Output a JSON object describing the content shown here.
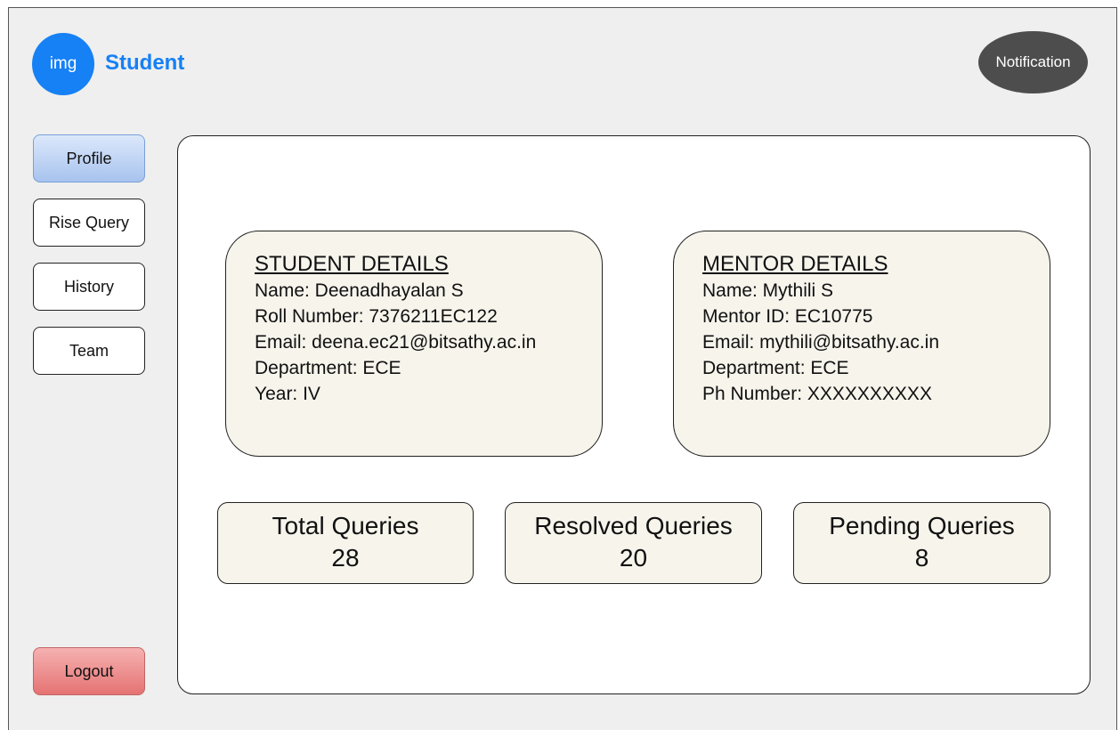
{
  "header": {
    "avatar_label": "img",
    "app_title": "Student",
    "notification_label": "Notification"
  },
  "sidebar": {
    "items": [
      {
        "label": "Profile",
        "active": true
      },
      {
        "label": "Rise Query",
        "active": false
      },
      {
        "label": "History",
        "active": false
      },
      {
        "label": "Team",
        "active": false
      }
    ],
    "logout_label": "Logout"
  },
  "student_details": {
    "heading": "STUDENT DETAILS",
    "lines": [
      "Name: Deenadhayalan S",
      "Roll Number: 7376211EC122",
      "Email: deena.ec21@bitsathy.ac.in",
      "Department: ECE",
      "Year: IV"
    ]
  },
  "mentor_details": {
    "heading": "MENTOR DETAILS",
    "lines": [
      "Name: Mythili S",
      "Mentor ID: EC10775",
      "Email: mythili@bitsathy.ac.in",
      "Department: ECE",
      "Ph Number: XXXXXXXXXX"
    ]
  },
  "stats": [
    {
      "label": "Total Queries",
      "value": "28"
    },
    {
      "label": "Resolved Queries",
      "value": "20"
    },
    {
      "label": "Pending Queries",
      "value": "8"
    }
  ],
  "colors": {
    "brand": "#1680f5",
    "background": "#efefef",
    "card": "#f7f4ec",
    "notification": "#4d4d4d",
    "active_nav": "#a7c3ee",
    "logout": "#e57373"
  }
}
